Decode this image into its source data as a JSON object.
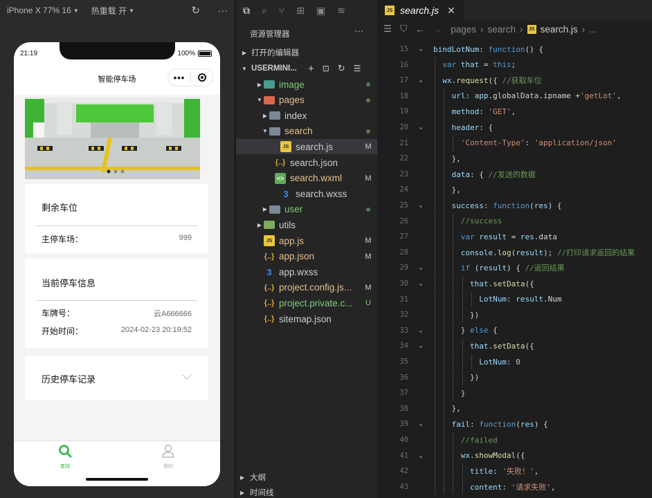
{
  "simulator": {
    "device": "iPhone X 77% 16",
    "hot_reload": "热重载 开",
    "status_time": "21:19",
    "battery": "100%",
    "nav_title": "智能停车场",
    "remaining_card": {
      "title": "剩余车位",
      "row_label": "主停车场：",
      "row_value": "999"
    },
    "current_card": {
      "title": "当前停车信息",
      "plate_label": "车牌号：",
      "plate_value": "云A666666",
      "start_label": "开始时间：",
      "start_value": "2024-02-23 20:19:52"
    },
    "history_card": {
      "title": "历史停车记录"
    },
    "tabs": [
      {
        "label": "查找",
        "color": "#2fb745"
      },
      {
        "label": "我的",
        "color": "#aaaaaa"
      }
    ]
  },
  "explorer": {
    "title": "资源管理器",
    "open_editors": "打开的编辑器",
    "project": "USERMINI...",
    "tree": [
      {
        "label": "image",
        "status": "dot",
        "kind": "folder-img",
        "color": "green"
      },
      {
        "label": "pages",
        "status": "dot",
        "kind": "folder-pages",
        "color": "orange"
      },
      {
        "label": "index",
        "status": "",
        "kind": "folder",
        "color": "grey"
      },
      {
        "label": "search",
        "status": "dot",
        "kind": "folder-open",
        "color": "orange"
      },
      {
        "label": "search.js",
        "status": "M",
        "kind": "js",
        "color": "grey"
      },
      {
        "label": "search.json",
        "status": "",
        "kind": "json",
        "color": "grey"
      },
      {
        "label": "search.wxml",
        "status": "M",
        "kind": "wxml",
        "color": "orange"
      },
      {
        "label": "search.wxss",
        "status": "",
        "kind": "css",
        "color": "grey"
      },
      {
        "label": "user",
        "status": "dot",
        "kind": "folder",
        "color": "green"
      },
      {
        "label": "utils",
        "status": "",
        "kind": "folder-utils",
        "color": "grey"
      },
      {
        "label": "app.js",
        "status": "M",
        "kind": "js",
        "color": "orange"
      },
      {
        "label": "app.json",
        "status": "M",
        "kind": "json",
        "color": "orange"
      },
      {
        "label": "app.wxss",
        "status": "",
        "kind": "css",
        "color": "grey"
      },
      {
        "label": "project.config.js...",
        "status": "M",
        "kind": "json",
        "color": "orange"
      },
      {
        "label": "project.private.c...",
        "status": "U",
        "kind": "json",
        "color": "green"
      },
      {
        "label": "sitemap.json",
        "status": "",
        "kind": "json",
        "color": "grey"
      }
    ],
    "outline": "大纲",
    "timeline": "时间线"
  },
  "editor": {
    "tab": "search.js",
    "breadcrumb": [
      "pages",
      "search",
      "search.js",
      "..."
    ],
    "lines": [
      {
        "n": "15",
        "fold": true,
        "code": "bindLotNum: function() {"
      },
      {
        "n": "16",
        "fold": false,
        "code": "  var that = this;"
      },
      {
        "n": "17",
        "fold": true,
        "code": "  wx.request({ //获取车位"
      },
      {
        "n": "18",
        "fold": false,
        "code": "    url: app.globalData.ipname +'getLot',"
      },
      {
        "n": "19",
        "fold": false,
        "code": "    method: 'GET',"
      },
      {
        "n": "20",
        "fold": true,
        "code": "    header: {"
      },
      {
        "n": "21",
        "fold": false,
        "code": "      'Content-Type': 'application/json'"
      },
      {
        "n": "22",
        "fold": false,
        "code": "    },"
      },
      {
        "n": "23",
        "fold": false,
        "code": "    data: { //发送的数据"
      },
      {
        "n": "24",
        "fold": false,
        "code": "    },"
      },
      {
        "n": "25",
        "fold": true,
        "code": "    success: function(res) {"
      },
      {
        "n": "26",
        "fold": false,
        "code": "      //success"
      },
      {
        "n": "27",
        "fold": false,
        "code": "      var result = res.data"
      },
      {
        "n": "28",
        "fold": false,
        "code": "      console.log(result); //打印请求返回的结果"
      },
      {
        "n": "29",
        "fold": true,
        "code": "      if (result) { //返回结果"
      },
      {
        "n": "30",
        "fold": true,
        "code": "        that.setData({"
      },
      {
        "n": "31",
        "fold": false,
        "code": "          LotNum: result.Num"
      },
      {
        "n": "32",
        "fold": false,
        "code": "        })"
      },
      {
        "n": "33",
        "fold": true,
        "code": "      } else {"
      },
      {
        "n": "34",
        "fold": true,
        "code": "        that.setData({"
      },
      {
        "n": "35",
        "fold": false,
        "code": "          LotNum: 0"
      },
      {
        "n": "36",
        "fold": false,
        "code": "        })"
      },
      {
        "n": "37",
        "fold": false,
        "code": "      }"
      },
      {
        "n": "38",
        "fold": false,
        "code": "    },"
      },
      {
        "n": "39",
        "fold": true,
        "code": "    fail: function(res) {"
      },
      {
        "n": "40",
        "fold": false,
        "code": "      //failed"
      },
      {
        "n": "41",
        "fold": true,
        "code": "      wx.showModal({"
      },
      {
        "n": "42",
        "fold": false,
        "code": "        title: '失败！',"
      },
      {
        "n": "43",
        "fold": false,
        "code": "        content: '请求失败',"
      }
    ]
  }
}
